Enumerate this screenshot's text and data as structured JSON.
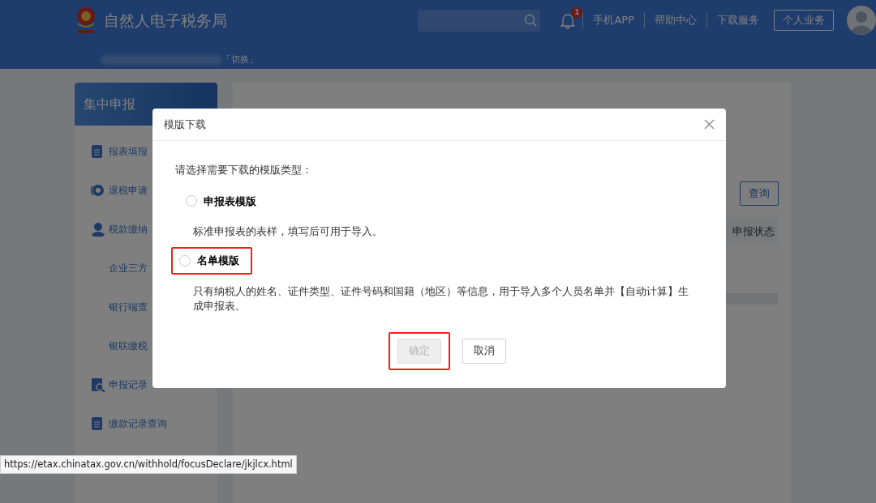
{
  "header": {
    "title": "自然人电子税务局",
    "notification_count": "1",
    "links": [
      "手机APP",
      "帮助中心",
      "下载服务"
    ],
    "personal_button": "个人业务",
    "account_switch": "「切换」"
  },
  "sidebar": {
    "title": "集中申报",
    "items": [
      {
        "label": "报表填报",
        "kind": "document"
      },
      {
        "label": "退税申请",
        "kind": "refund"
      },
      {
        "label": "税款缴纳",
        "kind": "payment"
      },
      {
        "label": "企业三方",
        "kind": "sub"
      },
      {
        "label": "银行端查",
        "kind": "sub"
      },
      {
        "label": "银联缴税",
        "kind": "sub"
      },
      {
        "label": "申报记录",
        "kind": "record"
      },
      {
        "label": "缴款记录查询",
        "kind": "document"
      }
    ]
  },
  "main": {
    "query_button": "查询",
    "table": {
      "columns": [
        "申报状态"
      ]
    }
  },
  "dialog": {
    "title": "模版下载",
    "prompt": "请选择需要下载的模版类型：",
    "options": [
      {
        "label": "申报表模版",
        "description": "标准申报表的表样，填写后可用于导入。",
        "selected": false,
        "highlighted": false
      },
      {
        "label": "名单模版",
        "description": "只有纳税人的姓名、证件类型、证件号码和国籍（地区）等信息，用于导入多个人员名单并【自动计算】生成申报表。",
        "selected": false,
        "highlighted": true
      }
    ],
    "buttons": [
      {
        "label": "确定",
        "kind": "primary",
        "disabled": true,
        "highlighted": true
      },
      {
        "label": "取消",
        "kind": "secondary",
        "disabled": false,
        "highlighted": false
      }
    ]
  },
  "status_url": "https://etax.chinatax.gov.cn/withhold/focusDeclare/jkjlcx.html"
}
